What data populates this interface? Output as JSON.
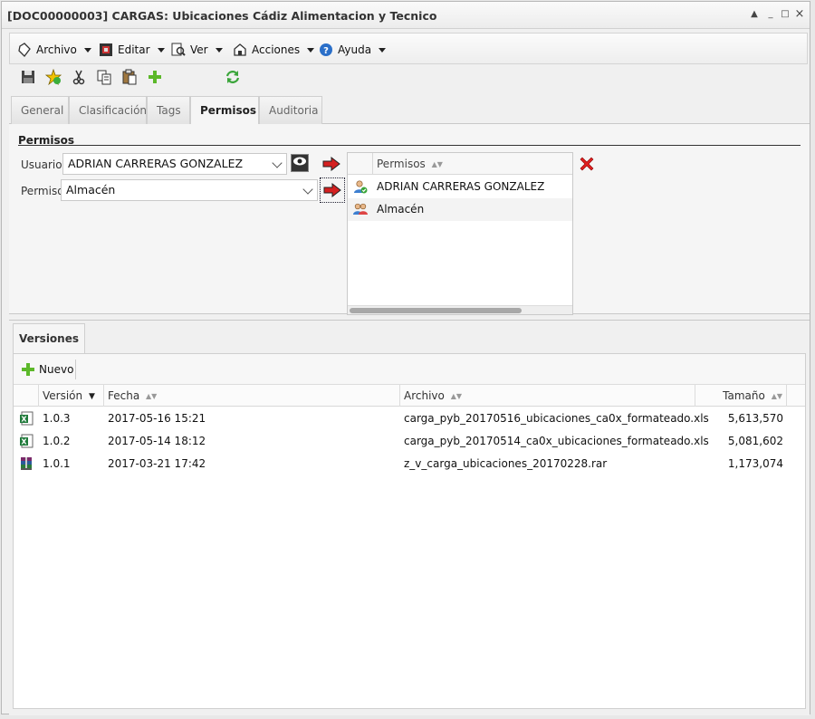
{
  "window": {
    "title": "[DOC00000003] CARGAS: Ubicaciones Cádiz Alimentacion y Tecnico",
    "controls": [
      "▲",
      "_",
      "□",
      "×"
    ]
  },
  "menubar": {
    "items": [
      {
        "label": "Archivo",
        "icon": "archive-icon"
      },
      {
        "label": "Editar",
        "icon": "edit-icon"
      },
      {
        "label": "Ver",
        "icon": "view-icon"
      },
      {
        "label": "Acciones",
        "icon": "actions-icon"
      },
      {
        "label": "Ayuda",
        "icon": "help-icon"
      }
    ]
  },
  "toolbar": {
    "icons": [
      "save-icon",
      "favorite-icon",
      "cut-icon",
      "copy-icon",
      "paste-icon",
      "add-icon",
      "refresh-icon"
    ]
  },
  "tabs": [
    {
      "label": "General"
    },
    {
      "label": "Clasificación"
    },
    {
      "label": "Tags"
    },
    {
      "label": "Permisos",
      "active": true
    },
    {
      "label": "Auditoria"
    }
  ],
  "permisos": {
    "section_title": "Permisos",
    "usuario_label": "Usuario",
    "usuario_value": "ADRIAN CARRERAS GONZALEZ",
    "permiso_label": "Permiso",
    "permiso_value": "Almacén",
    "grid": {
      "header": "Permisos",
      "rows": [
        {
          "label": "ADRIAN CARRERAS GONZALEZ",
          "type": "user"
        },
        {
          "label": "Almacén",
          "type": "group"
        }
      ]
    }
  },
  "versiones": {
    "tab_label": "Versiones",
    "new_button": "Nuevo",
    "columns": {
      "version": "Versión",
      "fecha": "Fecha",
      "archivo": "Archivo",
      "tamano": "Tamaño"
    },
    "rows": [
      {
        "version": "1.0.3",
        "fecha": "2017-05-16 15:21",
        "archivo": "carga_pyb_20170516_ubicaciones_ca0x_formateado.xls",
        "tamano": "5,613,570",
        "type": "excel"
      },
      {
        "version": "1.0.2",
        "fecha": "2017-05-14 18:12",
        "archivo": "carga_pyb_20170514_ca0x_ubicaciones_formateado.xls",
        "tamano": "5,081,602",
        "type": "excel"
      },
      {
        "version": "1.0.1",
        "fecha": "2017-03-21 17:42",
        "archivo": "z_v_carga_ubicaciones_20170228.rar",
        "tamano": "1,173,074",
        "type": "rar"
      }
    ]
  },
  "colors": {
    "accent_red": "#d42020",
    "excel_green": "#1f7a3a",
    "add_green": "#5cb82a"
  }
}
